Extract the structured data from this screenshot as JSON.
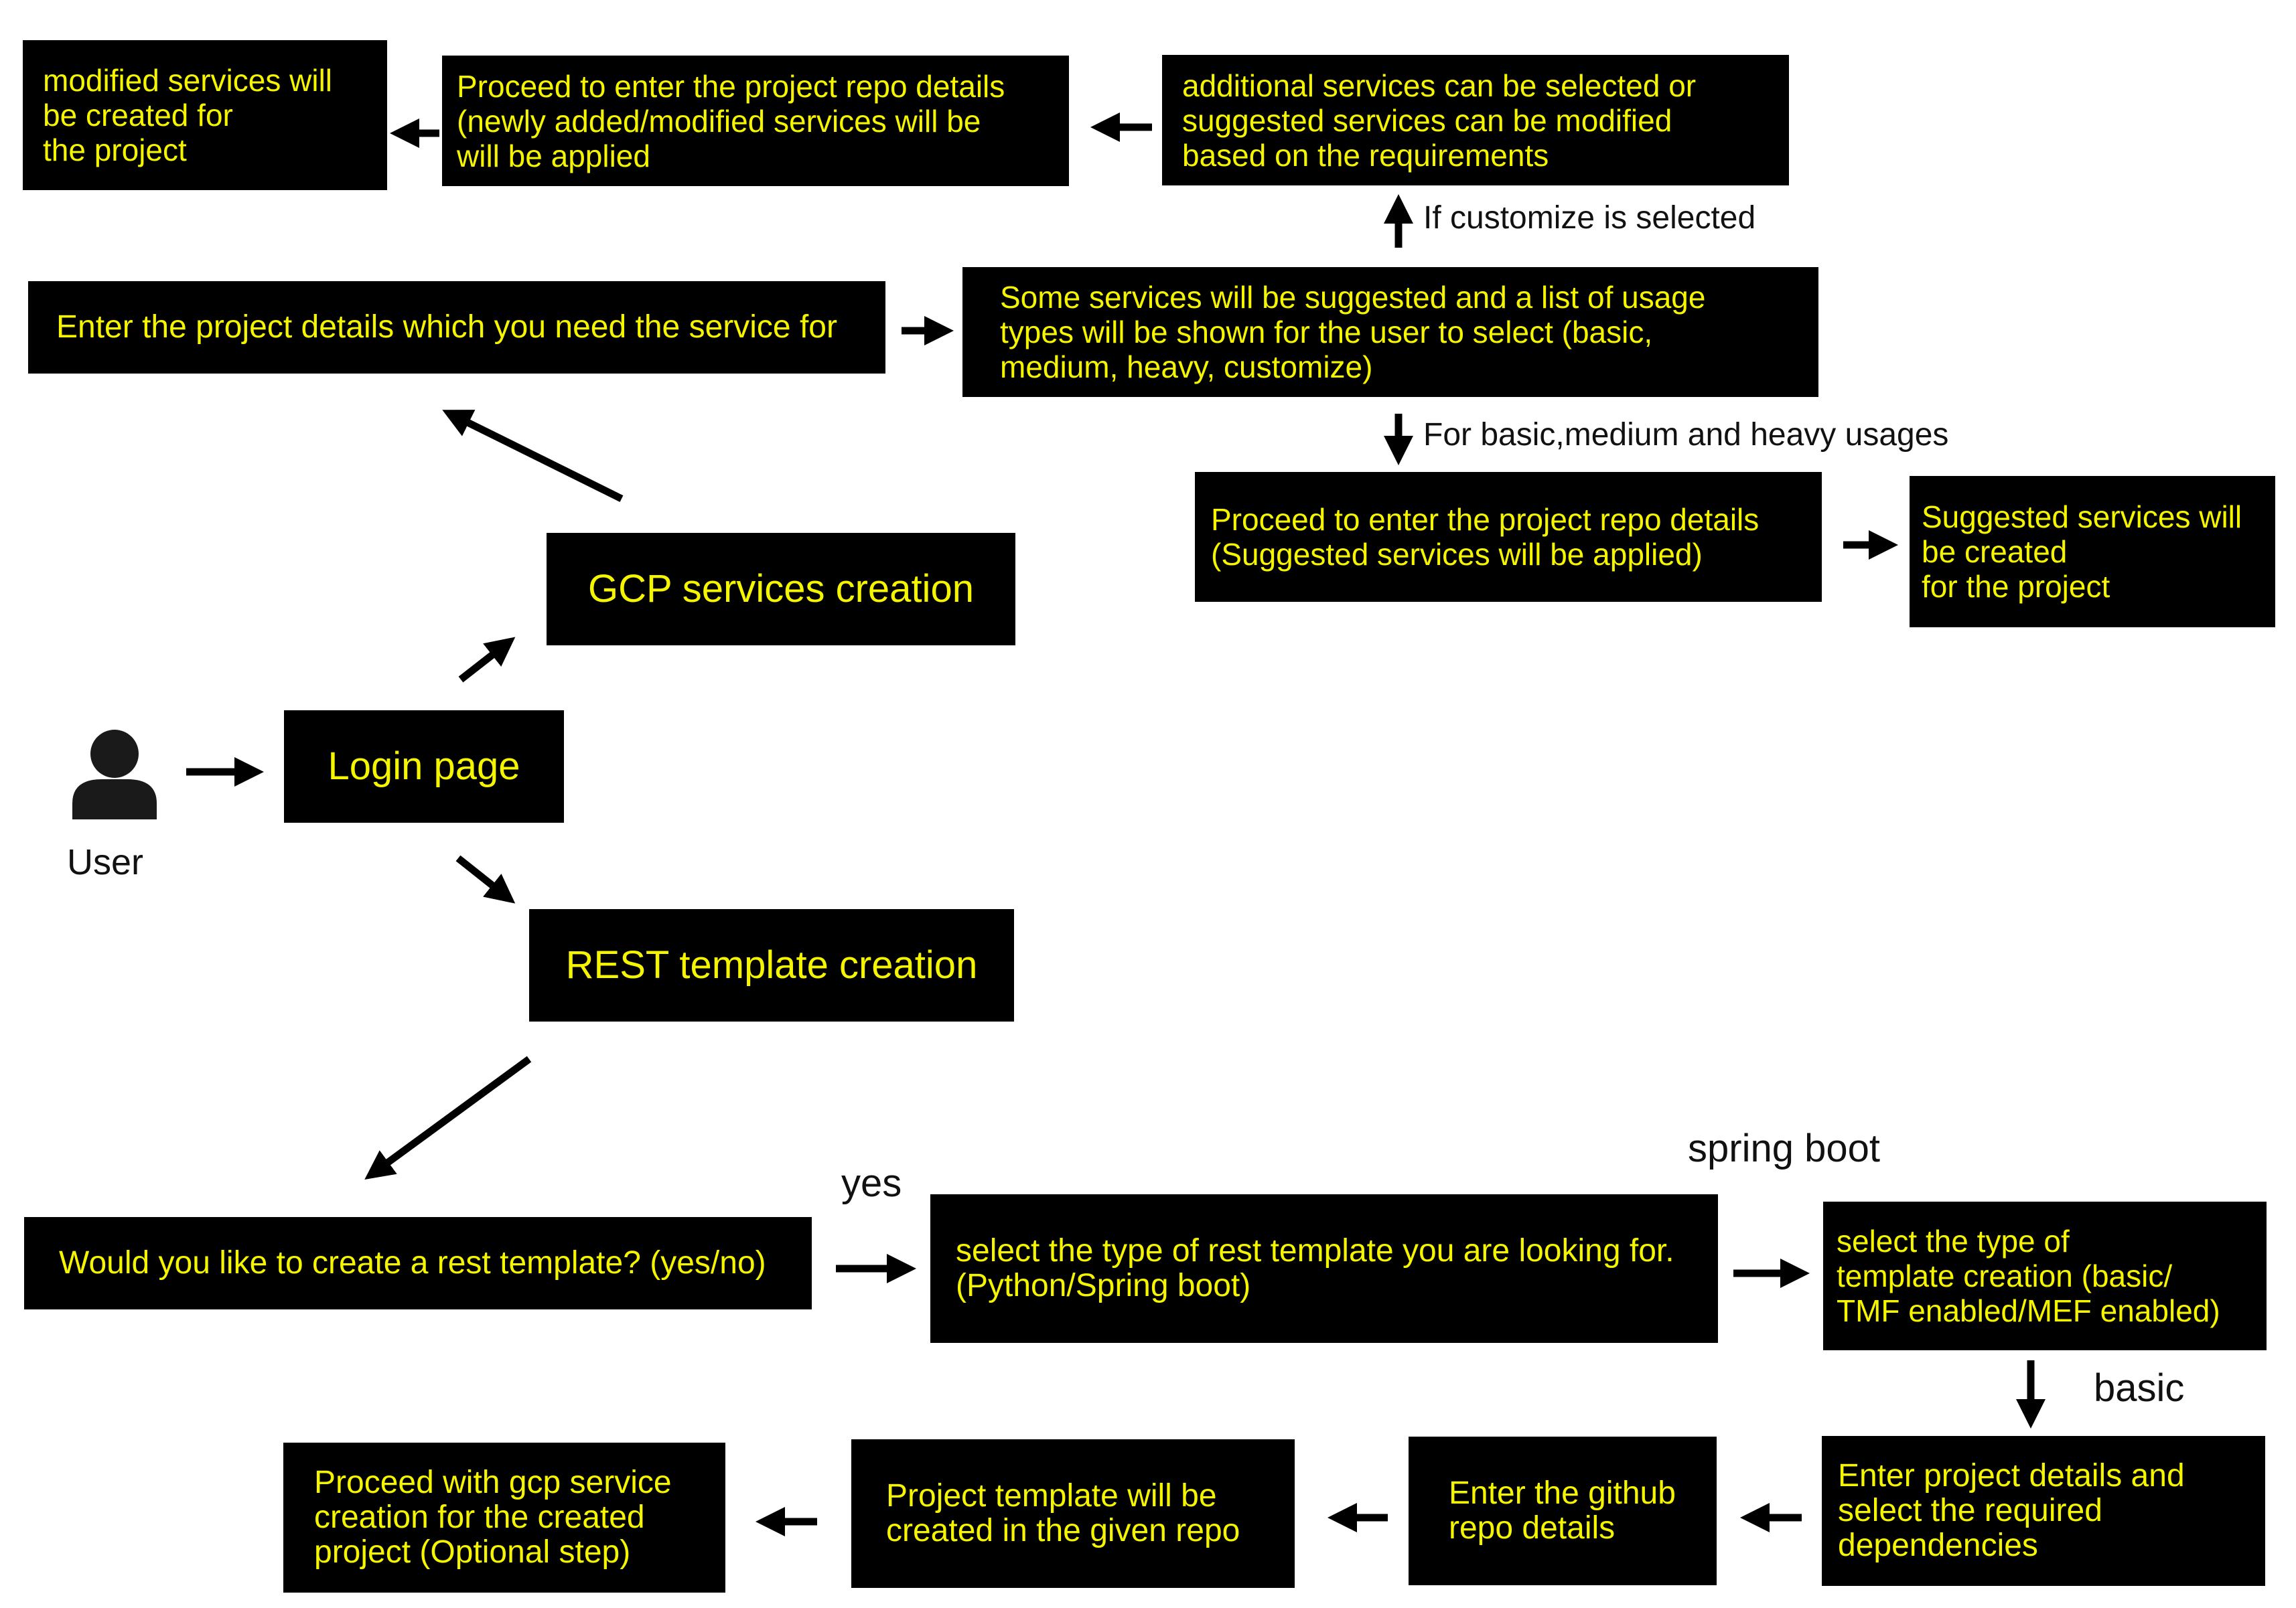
{
  "colors": {
    "box_bg": "#000000",
    "box_text": "#f5f500",
    "arrow": "#000000",
    "label": "#111111"
  },
  "user": {
    "icon": "user-icon",
    "label": "User"
  },
  "boxes": {
    "login": "Login page",
    "gcp": "GCP services creation",
    "rest": "REST template creation",
    "project_details": "Enter the project details which you need the service for",
    "suggested_list": "Some services will be suggested and a list of usage\ntypes will be shown for the user to select (basic,\nmedium, heavy, customize)",
    "additional_services": "additional services can be selected or\nsuggested services can be modified\nbased on the requirements",
    "proceed_modified": "Proceed to enter the project repo details\n(newly added/modified services will be\nwill be applied",
    "modified_created": "modified services will\nbe created for\nthe project",
    "proceed_suggested": "Proceed to enter the project repo details\n(Suggested services will be applied)",
    "suggested_created": "Suggested services will\nbe created\nfor the project",
    "rest_question": "Would you like to create a rest template? (yes/no)",
    "select_type": "select the type of rest template you are looking for.\n(Python/Spring boot)",
    "template_type": "select the type of\ntemplate creation (basic/\nTMF enabled/MEF enabled)",
    "enter_project": "Enter project details and\nselect the required\ndependencies",
    "github": "Enter the github\nrepo details",
    "template_created": "Project template will be\ncreated in the given repo",
    "proceed_gcp": "Proceed with gcp service\ncreation for the created\nproject (Optional step)"
  },
  "labels": {
    "customize": "If customize is selected",
    "basic_medium_heavy": "For basic,medium and heavy usages",
    "yes": "yes",
    "spring_boot": "spring boot",
    "basic": "basic"
  }
}
